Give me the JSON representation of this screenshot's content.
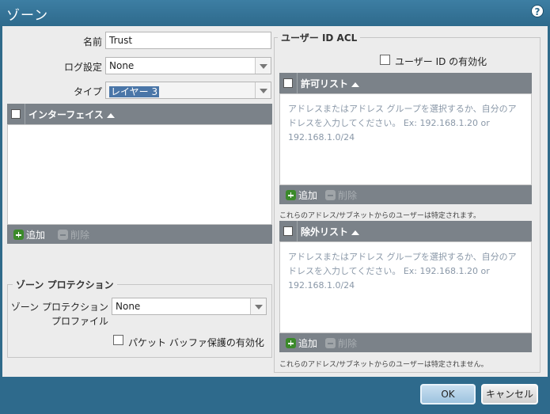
{
  "dialog": {
    "title": "ゾーン",
    "help_icon": "question-icon"
  },
  "form": {
    "name_label": "名前",
    "name_value": "Trust",
    "log_label": "ログ設定",
    "log_value": "None",
    "type_label": "タイプ",
    "type_value": "レイヤー 3"
  },
  "interfaces": {
    "header": "インターフェイス",
    "add": "追加",
    "delete": "削除"
  },
  "protection": {
    "legend": "ゾーン プロテクション",
    "profile_label_1": "ゾーン プロテクション",
    "profile_label_2": "プロファイル",
    "profile_value": "None",
    "packet_buffer_label": "パケット バッファ保護の有効化",
    "packet_buffer_checked": false
  },
  "user_acl": {
    "legend": "ユーザー ID ACL",
    "enable_label": "ユーザー ID の有効化",
    "enable_checked": false,
    "include": {
      "header": "許可リスト",
      "placeholder_1": "アドレスまたはアドレス グループを選択するか、自分のア",
      "placeholder_2": "ドレスを入力してください。 Ex: 192.168.1.20 or",
      "placeholder_3": "192.168.1.0/24",
      "add": "追加",
      "delete": "削除",
      "note": "これらのアドレス/サブネットからのユーザーは特定されます。"
    },
    "exclude": {
      "header": "除外リスト",
      "placeholder_1": "アドレスまたはアドレス グループを選択するか、自分のア",
      "placeholder_2": "ドレスを入力してください。 Ex: 192.168.1.20 or",
      "placeholder_3": "192.168.1.0/24",
      "add": "追加",
      "delete": "削除",
      "note": "これらのアドレス/サブネットからのユーザーは特定されません。"
    }
  },
  "buttons": {
    "ok": "OK",
    "cancel": "キャンセル"
  }
}
